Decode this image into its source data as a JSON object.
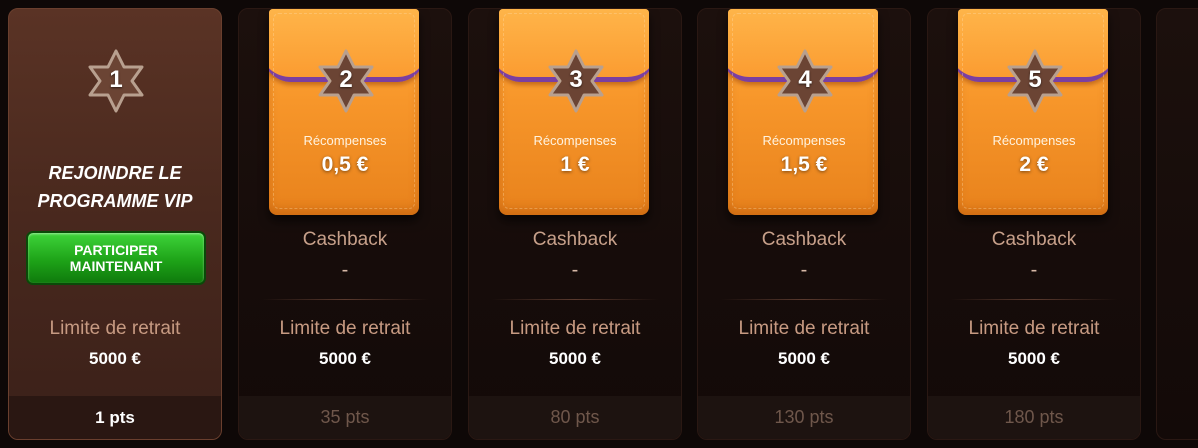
{
  "first_card": {
    "level": "1",
    "title_line1": "REJOINDRE LE",
    "title_line2": "PROGRAMME VIP",
    "button_line1": "PARTICIPER",
    "button_line2": "MAINTENANT",
    "limit_label": "Limite de retrait",
    "limit_value": "5000 €",
    "points": "1 pts"
  },
  "tiers": [
    {
      "level": "2",
      "reward_label": "Récompenses",
      "reward_value": "0,5 €",
      "cashback_label": "Cashback",
      "cashback_value": "-",
      "limit_label": "Limite de retrait",
      "limit_value": "5000 €",
      "points": "35 pts"
    },
    {
      "level": "3",
      "reward_label": "Récompenses",
      "reward_value": "1 €",
      "cashback_label": "Cashback",
      "cashback_value": "-",
      "limit_label": "Limite de retrait",
      "limit_value": "5000 €",
      "points": "80 pts"
    },
    {
      "level": "4",
      "reward_label": "Récompenses",
      "reward_value": "1,5 €",
      "cashback_label": "Cashback",
      "cashback_value": "-",
      "limit_label": "Limite de retrait",
      "limit_value": "5000 €",
      "points": "130 pts"
    },
    {
      "level": "5",
      "reward_label": "Récompenses",
      "reward_value": "2 €",
      "cashback_label": "Cashback",
      "cashback_value": "-",
      "limit_label": "Limite de retrait",
      "limit_value": "5000 €",
      "points": "180 pts"
    }
  ],
  "colors": {
    "star_fill": "#6b4434",
    "wallet_orange": "#f7962a",
    "button_green": "#1ea318"
  },
  "icons": {
    "level_badge": "six-point-star-icon",
    "wallet": "wallet-icon"
  }
}
